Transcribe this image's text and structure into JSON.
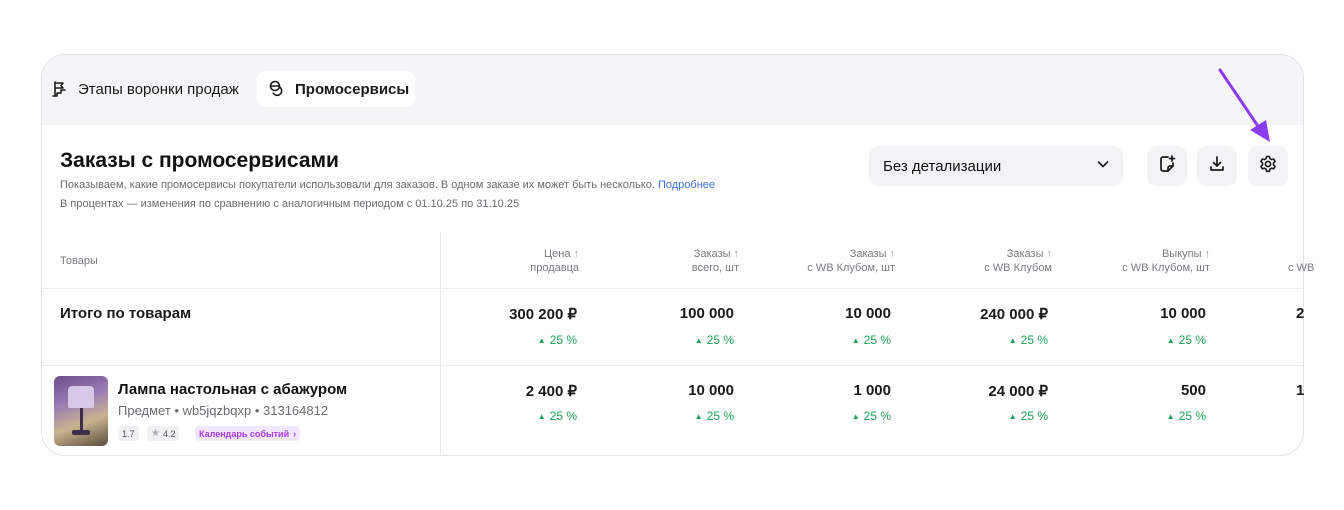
{
  "tabs": [
    {
      "label": "Этапы воронки продаж"
    },
    {
      "label": "Промосервисы"
    }
  ],
  "header": {
    "title": "Заказы с промосервисами",
    "desc1": "Показываем, какие промосервисы покупатели использовали для заказов. В одном заказе их может быть несколько.",
    "desc1_link": "Подробнее",
    "desc2": "В процентах — изменения по сравнению с аналогичным периодом с 01.10.25 по 31.10.25"
  },
  "controls": {
    "detail_select": "Без детализации"
  },
  "table": {
    "products_header": "Товары",
    "columns": [
      {
        "line1": "Цена",
        "line2": "продавца"
      },
      {
        "line1": "Заказы",
        "line2": "всего, шт"
      },
      {
        "line1": "Заказы",
        "line2": "с WB Клубом, шт"
      },
      {
        "line1": "Заказы",
        "line2": "с WB Клубом"
      },
      {
        "line1": "Выкупы",
        "line2": "с WB Клубом, шт"
      },
      {
        "line1": "",
        "line2": "с WB"
      }
    ],
    "total": {
      "label": "Итого по товарам",
      "values": [
        "300 200 ₽",
        "100 000",
        "10 000",
        "240 000 ₽",
        "10 000",
        "2"
      ],
      "deltas": [
        "25 %",
        "25 %",
        "25 %",
        "25 %",
        "25 %"
      ]
    },
    "rows": [
      {
        "name": "Лампа настольная с абажуром",
        "meta": "Предмет • wb5jqzbqxp • 313164812",
        "version": "1.7",
        "rating": "4.2",
        "tag": "Календарь событий",
        "values": [
          "2 400 ₽",
          "10 000",
          "1 000",
          "24 000 ₽",
          "500",
          "1"
        ],
        "deltas": [
          "25 %",
          "25 %",
          "25 %",
          "25 %",
          "25 %"
        ]
      }
    ]
  },
  "colors": {
    "positive": "#1a9e56",
    "accent_purple": "#8b3cf0",
    "link": "#3b6fe0"
  }
}
